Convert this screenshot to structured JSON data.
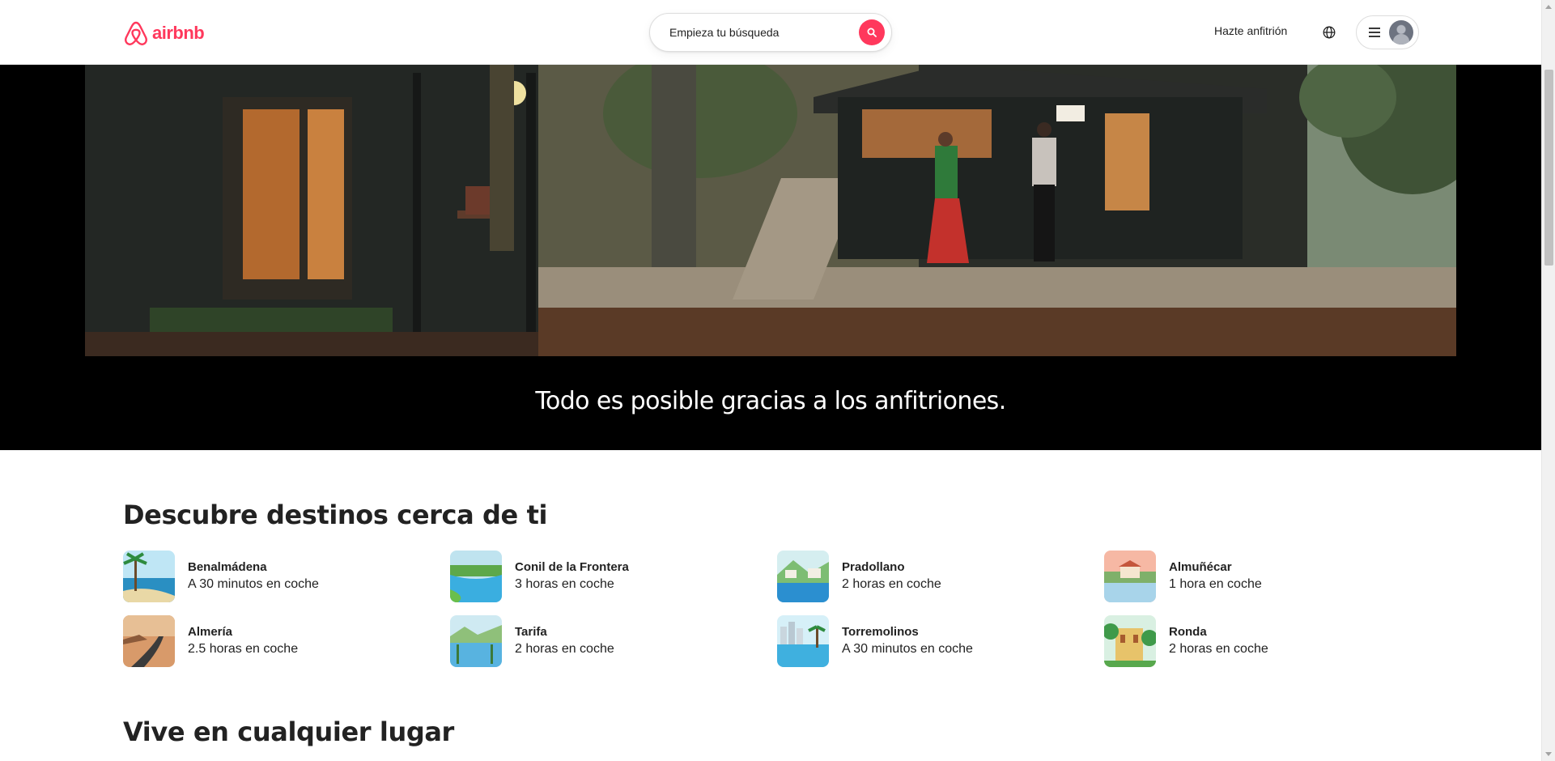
{
  "header": {
    "logo_text": "airbnb",
    "search_placeholder": "Empieza tu búsqueda",
    "host_link": "Hazte anfitrión"
  },
  "hero": {
    "caption": "Todo es posible gracias a los anfitriones."
  },
  "nearby": {
    "title": "Descubre destinos cerca de ti",
    "destinations": [
      {
        "name": "Benalmádena",
        "distance": "A 30 minutos en coche"
      },
      {
        "name": "Conil de la Frontera",
        "distance": "3 horas en coche"
      },
      {
        "name": "Pradollano",
        "distance": "2 horas en coche"
      },
      {
        "name": "Almuñécar",
        "distance": "1 hora en coche"
      },
      {
        "name": "Almería",
        "distance": "2.5 horas en coche"
      },
      {
        "name": "Tarifa",
        "distance": "2 horas en coche"
      },
      {
        "name": "Torremolinos",
        "distance": "A 30 minutos en coche"
      },
      {
        "name": "Ronda",
        "distance": "2 horas en coche"
      }
    ]
  },
  "live_anywhere": {
    "title": "Vive en cualquier lugar"
  },
  "colors": {
    "brand": "#ff385c",
    "text": "#222222",
    "hero_bg": "#000000"
  }
}
